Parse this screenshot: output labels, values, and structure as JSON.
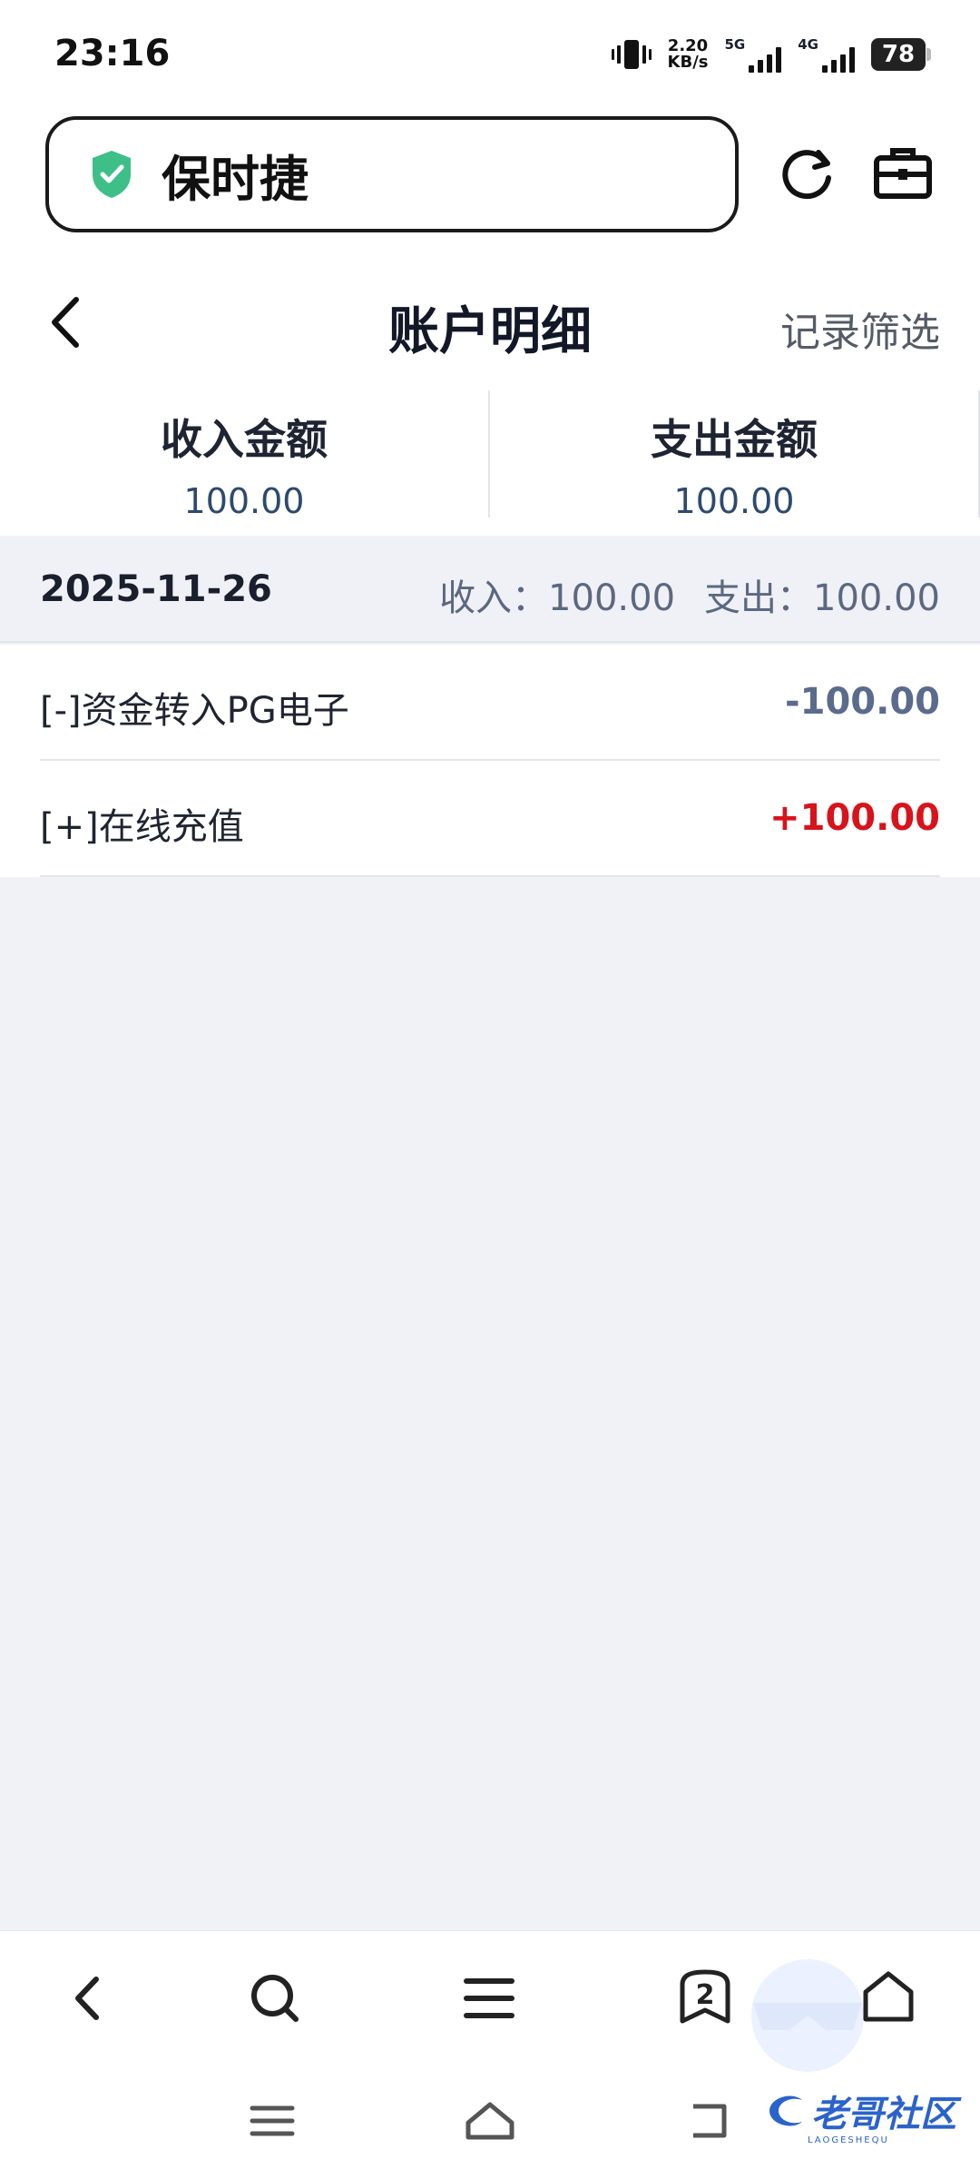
{
  "status_bar": {
    "time": "23:16",
    "speed_value": "2.20",
    "speed_unit": "KB/s",
    "net1": "5G",
    "net2": "4G",
    "battery": "78"
  },
  "browser": {
    "site_title": "保时捷"
  },
  "page": {
    "title": "账户明细",
    "filter_label": "记录筛选"
  },
  "summary": {
    "income_label": "收入金额",
    "income_value": "100.00",
    "expense_label": "支出金额",
    "expense_value": "100.00"
  },
  "day_group": {
    "date": "2025-11-26",
    "income_text": "收入：100.00",
    "expense_text": "支出：100.00"
  },
  "records": [
    {
      "name": "[-]资金转入PG电子",
      "amount": "-100.00",
      "type": "expense"
    },
    {
      "name": "[+]在线充值",
      "amount": "+100.00",
      "type": "income"
    }
  ],
  "bottom_nav": {
    "tab_count": "2"
  },
  "colors": {
    "shield": "#3fbf88",
    "income_amount": "#d8131b",
    "expense_amount": "#5b6b8c",
    "summary_value": "#2d4a6e"
  },
  "watermark": {
    "brand": "老哥社区",
    "brand_sub": "LAOGESHEQU"
  }
}
